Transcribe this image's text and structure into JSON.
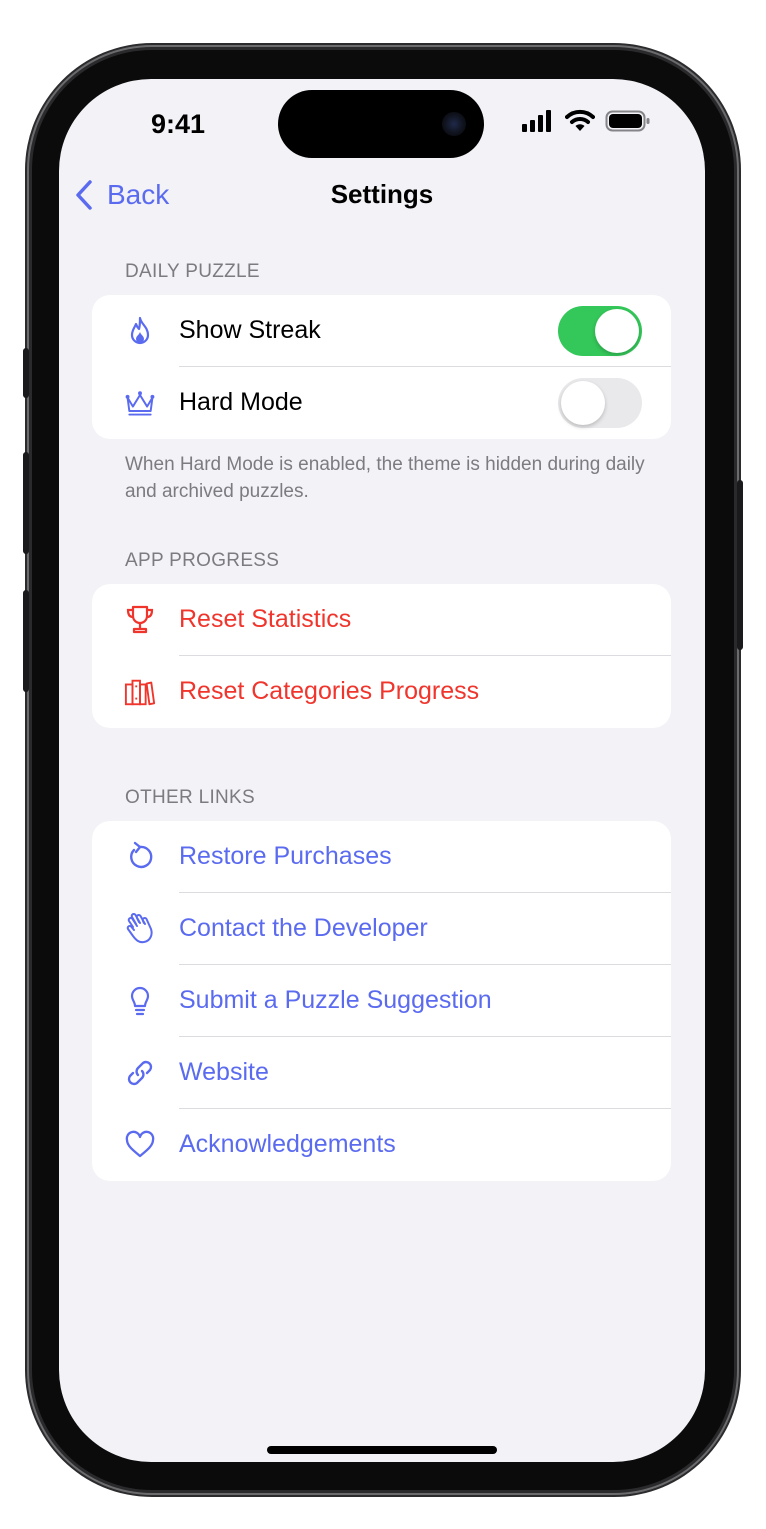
{
  "status_bar": {
    "time": "9:41"
  },
  "nav": {
    "back_label": "Back",
    "title": "Settings"
  },
  "colors": {
    "accent": "#5b6bf0",
    "destructive": "#f0352c",
    "toggle_on": "#34c759",
    "background": "#f2f2f7"
  },
  "daily_puzzle": {
    "header": "DAILY PUZZLE",
    "rows": [
      {
        "icon": "flame-icon",
        "label": "Show Streak",
        "toggle_on": true
      },
      {
        "icon": "crown-icon",
        "label": "Hard Mode",
        "toggle_on": false
      }
    ],
    "footer": "When Hard Mode is enabled, the theme is hidden during daily and archived puzzles."
  },
  "app_progress": {
    "header": "APP PROGRESS",
    "rows": [
      {
        "icon": "trophy-icon",
        "label": "Reset Statistics"
      },
      {
        "icon": "books-icon",
        "label": "Reset Categories Progress"
      }
    ]
  },
  "other_links": {
    "header": "OTHER LINKS",
    "rows": [
      {
        "icon": "restore-icon",
        "label": "Restore Purchases"
      },
      {
        "icon": "waving-hand-icon",
        "label": "Contact the Developer"
      },
      {
        "icon": "lightbulb-icon",
        "label": "Submit a Puzzle Suggestion"
      },
      {
        "icon": "link-icon",
        "label": "Website"
      },
      {
        "icon": "heart-icon",
        "label": "Acknowledgements"
      }
    ]
  }
}
